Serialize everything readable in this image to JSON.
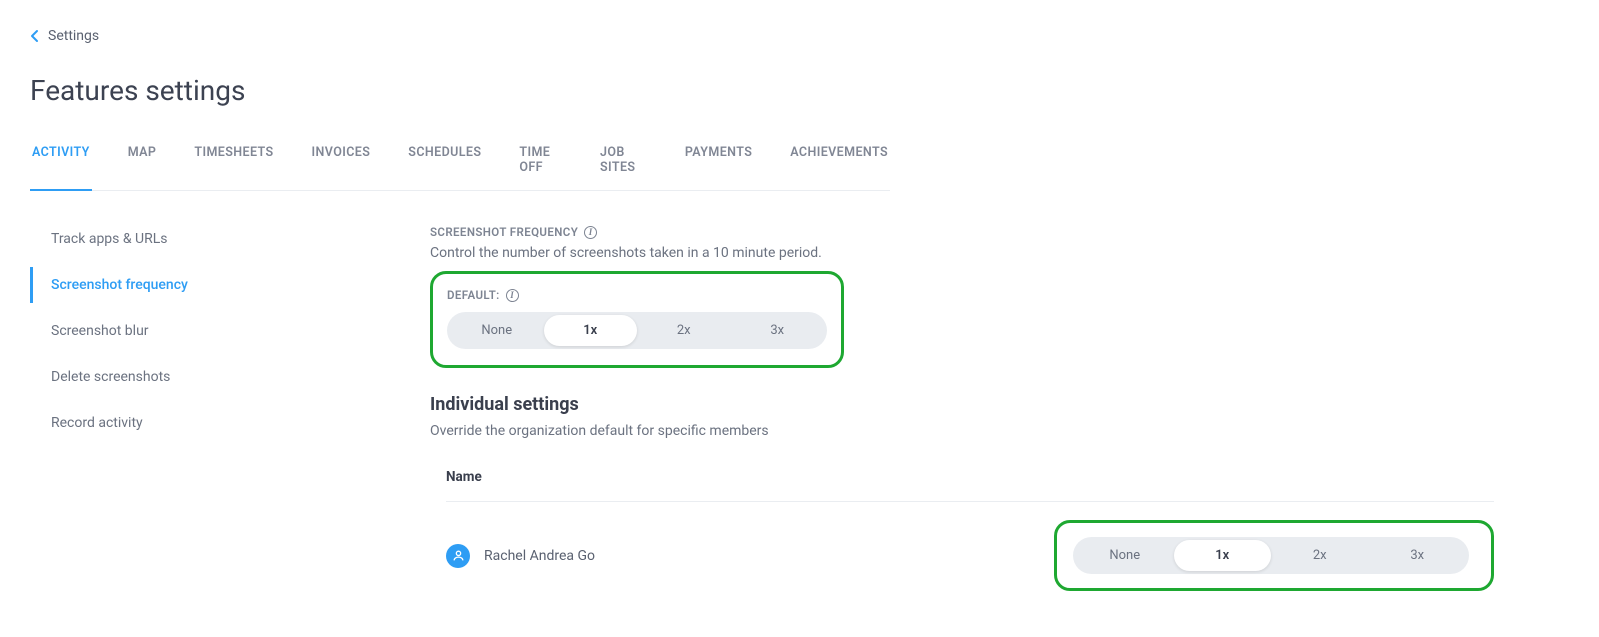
{
  "breadcrumb": {
    "label": "Settings"
  },
  "page_title": "Features settings",
  "tabs": [
    {
      "label": "ACTIVITY",
      "active": true
    },
    {
      "label": "MAP"
    },
    {
      "label": "TIMESHEETS"
    },
    {
      "label": "INVOICES"
    },
    {
      "label": "SCHEDULES"
    },
    {
      "label": "TIME OFF"
    },
    {
      "label": "JOB SITES"
    },
    {
      "label": "PAYMENTS"
    },
    {
      "label": "ACHIEVEMENTS"
    }
  ],
  "side_nav": [
    {
      "label": "Track apps & URLs"
    },
    {
      "label": "Screenshot frequency",
      "active": true
    },
    {
      "label": "Screenshot blur"
    },
    {
      "label": "Delete screenshots"
    },
    {
      "label": "Record activity"
    }
  ],
  "section": {
    "label": "SCREENSHOT FREQUENCY",
    "description": "Control the number of screenshots taken in a 10 minute period.",
    "default_label": "DEFAULT:",
    "options": [
      "None",
      "1x",
      "2x",
      "3x"
    ],
    "selected": "1x"
  },
  "individual": {
    "title": "Individual settings",
    "description": "Override the organization default for specific members",
    "header_name": "Name",
    "rows": [
      {
        "name": "Rachel Andrea Go",
        "options": [
          "None",
          "1x",
          "2x",
          "3x"
        ],
        "selected": "1x"
      }
    ]
  }
}
